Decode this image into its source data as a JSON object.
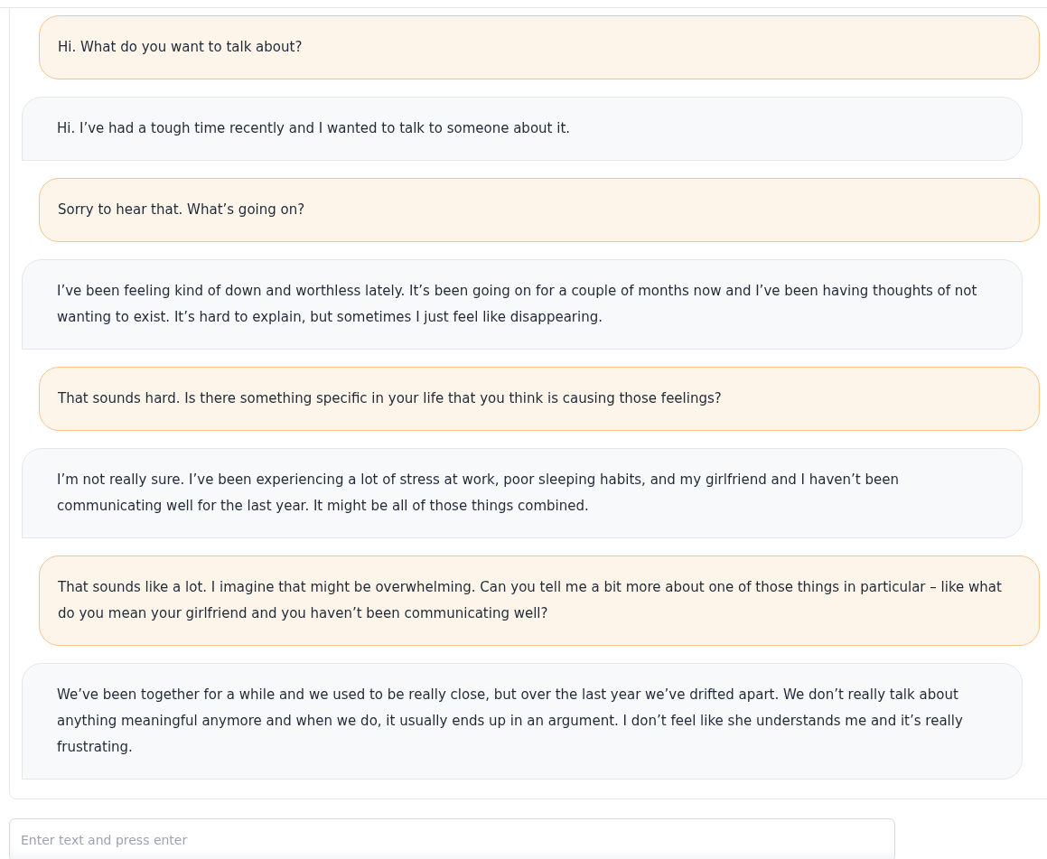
{
  "messages": [
    {
      "kind": "bot",
      "text": "Hi. What do you want to talk about?"
    },
    {
      "kind": "user",
      "text": "Hi. I’ve had a tough time recently and I wanted to talk to someone about it."
    },
    {
      "kind": "bot",
      "text": "Sorry to hear that. What’s going on?"
    },
    {
      "kind": "user",
      "text": "I’ve been feeling kind of down and worthless lately. It’s been going on for a couple of months now and I’ve been having thoughts of not wanting to exist. It’s hard to explain, but sometimes I just feel like disappearing."
    },
    {
      "kind": "bot",
      "text": "That sounds hard. Is there something specific in your life that you think is causing those feelings?"
    },
    {
      "kind": "user",
      "text": "I’m not really sure. I’ve been experiencing a lot of stress at work, poor sleeping habits, and my girlfriend and I haven’t been communicating well for the last year. It might be all of those things combined."
    },
    {
      "kind": "bot",
      "text": "That sounds like a lot. I imagine that might be overwhelming. Can you tell me a bit more about one of those things in particular – like what do you mean your girlfriend and you haven’t been communicating well?"
    },
    {
      "kind": "user",
      "text": "We’ve been together for a while and we used to be really close, but over the last year we’ve drifted apart. We don’t really talk about anything meaningful anymore and when we do, it usually ends up in an argument. I don’t feel like she understands me and it’s really frustrating."
    }
  ],
  "input": {
    "placeholder": "Enter text and press enter"
  }
}
